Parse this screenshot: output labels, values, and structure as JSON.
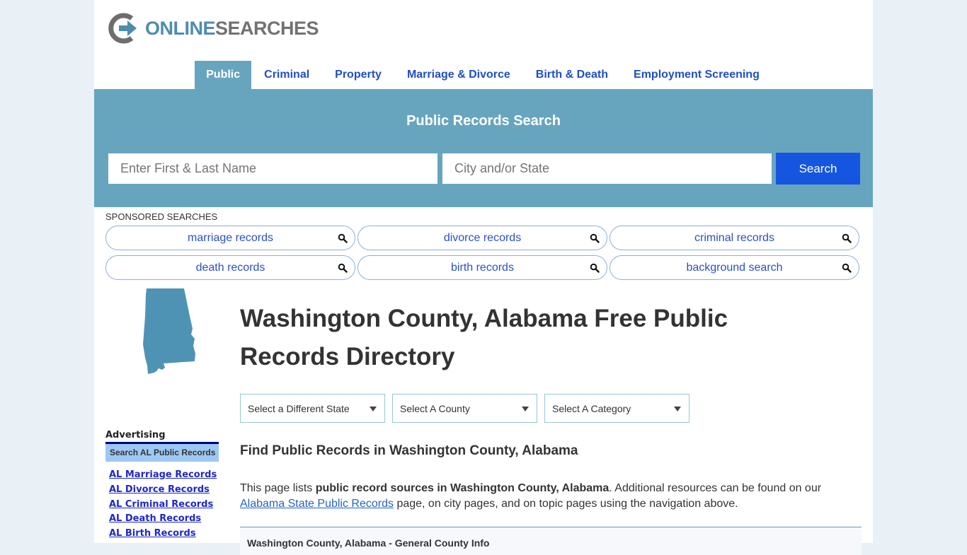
{
  "logo": {
    "part1": "ONLINE",
    "part2": "SEARCHES"
  },
  "nav": {
    "items": [
      {
        "label": "Public",
        "active": true
      },
      {
        "label": "Criminal"
      },
      {
        "label": "Property"
      },
      {
        "label": "Marriage & Divorce"
      },
      {
        "label": "Birth & Death"
      },
      {
        "label": "Employment Screening"
      }
    ]
  },
  "search": {
    "title": "Public Records Search",
    "name_placeholder": "Enter First & Last Name",
    "location_placeholder": "City and/or State",
    "button_label": "Search"
  },
  "sponsored": {
    "label": "SPONSORED SEARCHES",
    "items": [
      "marriage records",
      "divorce records",
      "criminal records",
      "death records",
      "birth records",
      "background search"
    ]
  },
  "state": {
    "name": "Alabama",
    "map_color": "#4f93b4"
  },
  "page": {
    "title": "Washington County, Alabama Free Public Records Directory",
    "selects": [
      "Select a Different State",
      "Select A County",
      "Select A Category"
    ],
    "find_title": "Find Public Records in Washington County, Alabama",
    "intro_1": "This page lists ",
    "intro_bold": "public record sources in Washington County, Alabama",
    "intro_2": ". Additional resources can be found on our ",
    "intro_link": "Alabama State Public Records",
    "intro_3": " page, on city pages, and on topic pages using the navigation above.",
    "info_heading": "Washington County, Alabama - General County Info"
  },
  "sidebar": {
    "advertising_label": "Advertising",
    "box_label": "Search AL Public Records",
    "links": [
      "AL Marriage Records",
      "AL Divorce Records",
      "AL Criminal Records",
      "AL Death Records",
      "AL Birth Records"
    ]
  }
}
